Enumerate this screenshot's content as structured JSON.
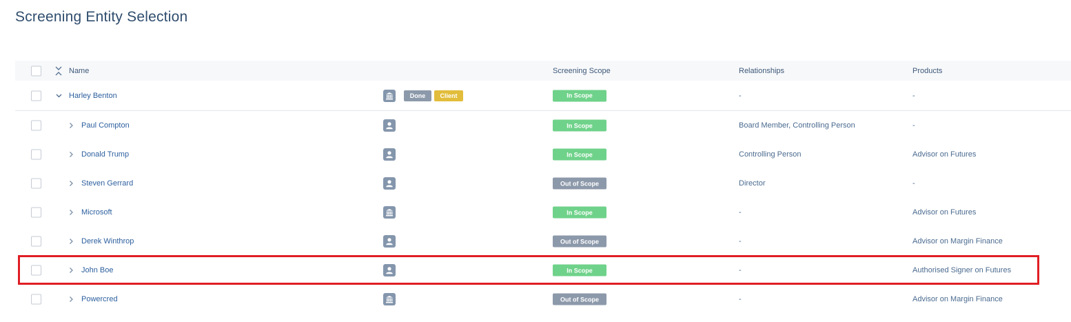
{
  "page": {
    "title": "Screening Entity Selection"
  },
  "table": {
    "headers": {
      "name": "Name",
      "scope": "Screening Scope",
      "relationships": "Relationships",
      "products": "Products"
    },
    "parent": {
      "name": "Harley Benton",
      "entity_type": "building-icon",
      "badges": [
        "Done",
        "Client"
      ],
      "scope": "In Scope",
      "relationships": "-",
      "products": "-"
    },
    "rows": [
      {
        "name": "Paul Compton",
        "entity_type": "person-icon",
        "scope": "In Scope",
        "relationships": "Board Member, Controlling Person",
        "products": "-"
      },
      {
        "name": "Donald Trump",
        "entity_type": "person-icon",
        "scope": "In Scope",
        "relationships": "Controlling Person",
        "products": "Advisor on Futures"
      },
      {
        "name": "Steven Gerrard",
        "entity_type": "person-icon",
        "scope": "Out of Scope",
        "relationships": "Director",
        "products": "-"
      },
      {
        "name": "Microsoft",
        "entity_type": "building-icon",
        "scope": "In Scope",
        "relationships": "-",
        "products": "Advisor on Futures"
      },
      {
        "name": "Derek Winthrop",
        "entity_type": "person-icon",
        "scope": "Out of Scope",
        "relationships": "-",
        "products": "Advisor on Margin Finance"
      },
      {
        "name": "John Boe",
        "entity_type": "person-icon",
        "scope": "In Scope",
        "relationships": "-",
        "products": "Authorised Signer on Futures"
      },
      {
        "name": "Powercred",
        "entity_type": "building-icon",
        "scope": "Out of Scope",
        "relationships": "-",
        "products": "Advisor on Margin Finance"
      }
    ]
  },
  "colors": {
    "in_scope": "#6fd28a",
    "out_of_scope": "#8c99aa",
    "done_badge": "#8c99aa",
    "client_badge": "#e2bd3b",
    "highlight": "#e01e25"
  }
}
